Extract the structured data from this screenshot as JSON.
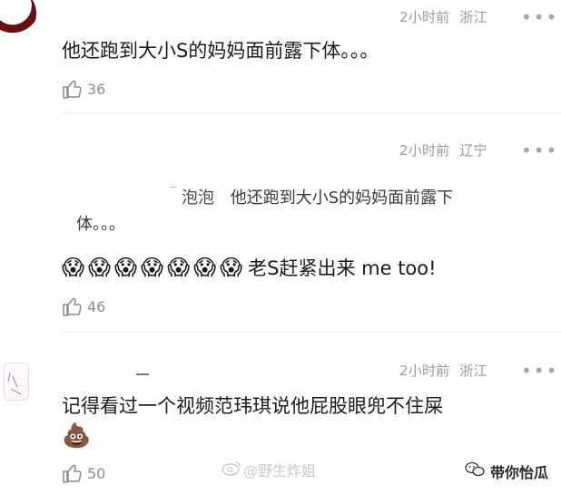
{
  "comments": [
    {
      "time": "2小时前",
      "location": "浙江",
      "more": "•••",
      "text": "他还跑到大小S的妈妈面前露下体。。。",
      "likes": "36"
    },
    {
      "time": "2小时前",
      "location": "辽宁",
      "more": "•••",
      "quote_user": "泡泡",
      "quote_line1": "他还跑到大小S的妈妈面前露下",
      "quote_line2": "体。。。",
      "emoji": "😱😱😱😱😱😱😱",
      "text": "老S赶紧出来 me too!",
      "likes": "46"
    },
    {
      "time": "2小时前",
      "location": "浙江",
      "more": "•••",
      "text": "记得看过一个视频范玮琪说他屁股眼兜不住屎",
      "emoji": "💩",
      "likes": "50"
    }
  ],
  "watermarks": {
    "weibo": "@野生炸姐",
    "wechat": "带你怡瓜"
  },
  "icons": {
    "thumbs_up": "thumbs-up-icon",
    "more": "more-dots-icon",
    "weibo": "weibo-icon",
    "wechat": "wechat-icon"
  }
}
